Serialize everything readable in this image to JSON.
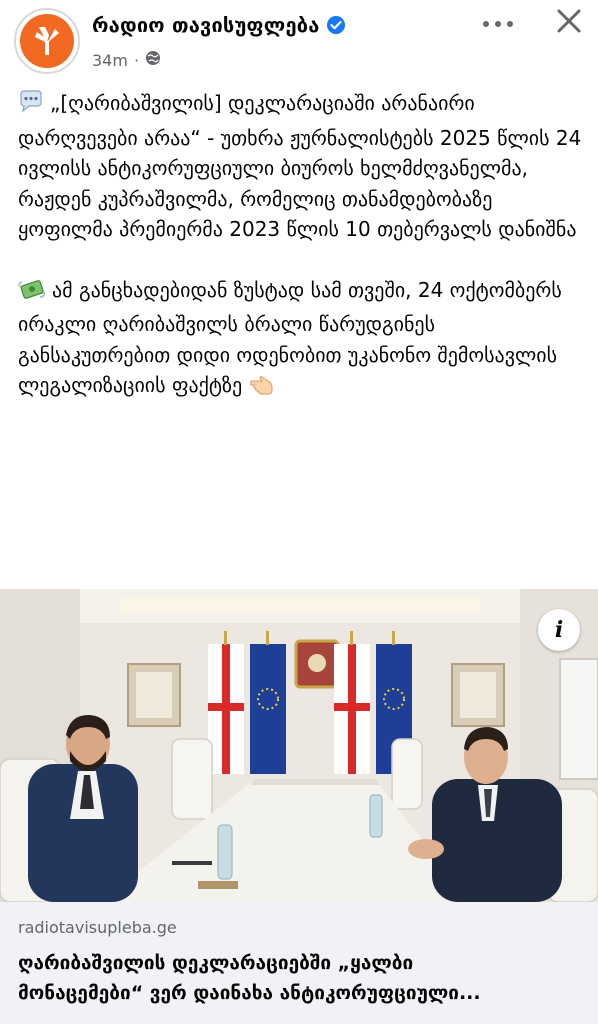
{
  "header": {
    "page_name": "რადიო თავისუფლება",
    "time": "34m",
    "brand_color": "#f26a21",
    "verified_color": "#1877f2",
    "icons": [
      "logo-icon",
      "verified-icon",
      "globe-icon",
      "more-icon",
      "close-icon"
    ]
  },
  "post": {
    "paragraph1_emoji": "speech-bubble-icon",
    "paragraph1": "„[ღარიბაშვილის] დეკლარაციაში არანაირი დარღვევები არაა“ - უთხრა ჟურნალისტებს 2025 წლის 24 ივლისს ანტიკორუფციული ბიუროს ხელმძღვანელმა, რაჟდენ კუპრაშვილმა, რომელიც თანამდებობაზე ყოფილმა პრემიერმა 2023 წლის 10 თებერვალს დანიშნა",
    "paragraph2_emoji": "money-with-wings-icon",
    "paragraph2": "ამ განცხადებიდან ზუსტად სამ თვეში, 24 ოქტომბერს ირაკლი ღარიბაშვილს ბრალი წარუდგინეს განსაკუთრებით დიდი ოდენობით უკანონო შემოსავლის ლეგალიზაციის ფაქტზე",
    "paragraph2_trailing_emoji": "backhand-index-pointing-left-icon"
  },
  "photo": {
    "info_label": "i"
  },
  "link": {
    "domain": "radiotavisupleba.ge",
    "title_line1": "ღარიბაშვილის დეკლარაციებში „ყალბი",
    "title_line2": "მონაცემები“ ვერ დაინახა ანტიკორუფციული..."
  }
}
